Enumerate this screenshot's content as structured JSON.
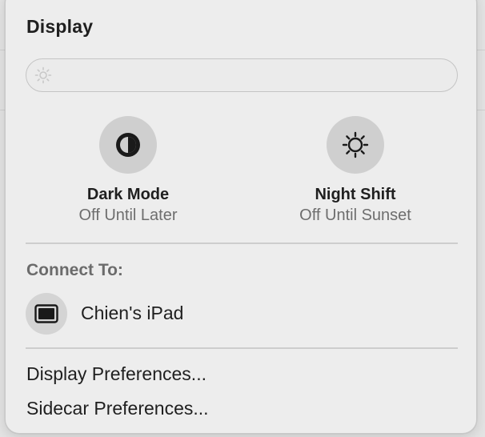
{
  "panel": {
    "title": "Display"
  },
  "brightness": {
    "icon": "sun-icon"
  },
  "toggles": [
    {
      "icon": "dark-mode-icon",
      "label": "Dark Mode",
      "status": "Off Until Later"
    },
    {
      "icon": "night-shift-icon",
      "label": "Night Shift",
      "status": "Off Until Sunset"
    }
  ],
  "connect": {
    "heading": "Connect To:",
    "devices": [
      {
        "icon": "ipad-icon",
        "name": "Chien's iPad"
      }
    ]
  },
  "menu": {
    "display_prefs": "Display Preferences...",
    "sidecar_prefs": "Sidecar Preferences..."
  },
  "colors": {
    "panel_background": "#ededed",
    "toggle_background": "#cfcfcf",
    "primary_text": "#1f1f1f",
    "secondary_text": "#6e6e6e"
  }
}
